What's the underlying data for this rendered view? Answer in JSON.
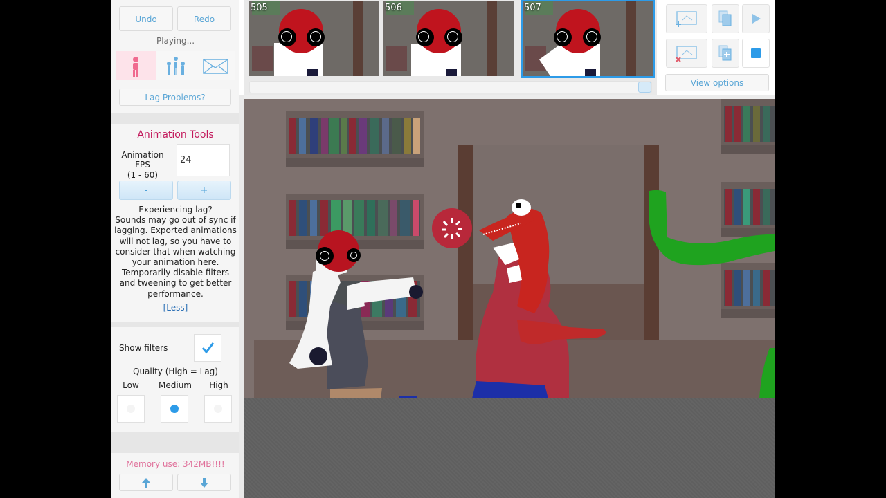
{
  "left_panel": {
    "undo_label": "Undo",
    "redo_label": "Redo",
    "status_text": "Playing...",
    "lag_problems_label": "Lag Problems?",
    "animation_tools": {
      "title": "Animation Tools",
      "fps_label_line1": "Animation FPS",
      "fps_label_line2": "(1 - 60)",
      "fps_value": "24",
      "minus_label": "-",
      "plus_label": "+",
      "lag_heading": "Experiencing lag?",
      "lag_text": "Sounds may go out of sync if lagging. Exported animations will not lag, so you have to consider that when watching your animation here. Temporarily disable filters and tweening to get better performance.",
      "less_link": "[Less]"
    },
    "filters": {
      "show_filters_label": "Show filters",
      "show_filters_checked": true,
      "quality_label": "Quality (High = Lag)",
      "options": [
        "Low",
        "Medium",
        "High"
      ],
      "selected": "Medium"
    },
    "memory_text": "Memory use: 342MB!!!!"
  },
  "timeline": {
    "frames": [
      {
        "number": "505",
        "selected": false
      },
      {
        "number": "506",
        "selected": false
      },
      {
        "number": "507",
        "selected": true
      }
    ]
  },
  "right_tools": {
    "view_options_label": "View options",
    "icons": [
      "add-frame-icon",
      "copy-icon",
      "play-icon",
      "delete-frame-icon",
      "paste-frame-icon",
      "stop-icon"
    ]
  },
  "colors": {
    "accent": "#2d9be8",
    "tools_title": "#c2185b",
    "memory_text": "#e0709a",
    "stage_wall": "#7e716e"
  }
}
